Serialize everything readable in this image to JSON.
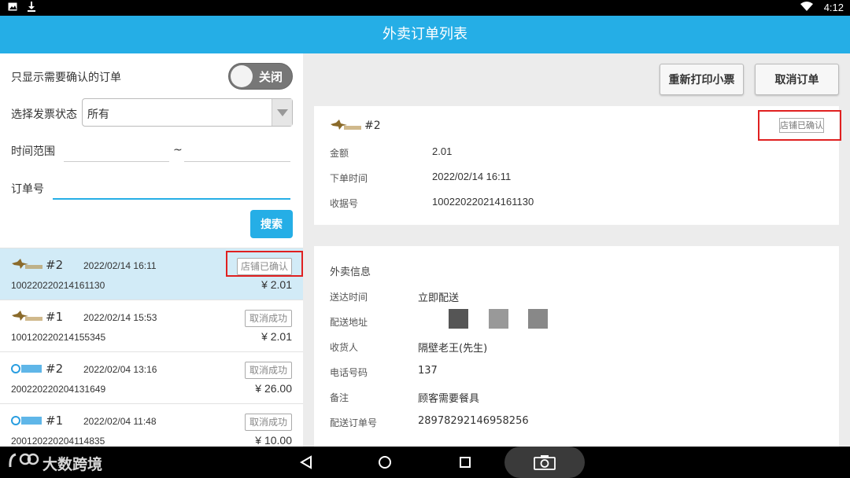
{
  "status_bar": {
    "time": "4:12"
  },
  "header": {
    "title": "外卖订单列表"
  },
  "filters": {
    "confirm_only_label": "只显示需要确认的订单",
    "toggle_label": "关闭",
    "invoice_label": "选择发票状态",
    "invoice_value": "所有",
    "time_range_label": "时间范围",
    "time_separator": "~",
    "order_no_label": "订单号",
    "search_label": "搜索"
  },
  "orders": [
    {
      "num": "#2",
      "date": "2022/02/14 16:11",
      "status": "店铺已确认",
      "id": "100220220214161130",
      "amount": "¥ 2.01",
      "platform": "meituan"
    },
    {
      "num": "#1",
      "date": "2022/02/14 15:53",
      "status": "取消成功",
      "id": "100120220214155345",
      "amount": "¥ 2.01",
      "platform": "meituan"
    },
    {
      "num": "#2",
      "date": "2022/02/04 13:16",
      "status": "取消成功",
      "id": "200220220204131649",
      "amount": "¥ 26.00",
      "platform": "eleme"
    },
    {
      "num": "#1",
      "date": "2022/02/04 11:48",
      "status": "取消成功",
      "id": "200120220204114835",
      "amount": "¥ 10.00",
      "platform": "eleme"
    }
  ],
  "actions": {
    "reprint_label": "重新打印小票",
    "cancel_label": "取消订单"
  },
  "detail": {
    "num": "#2",
    "status": "店铺已确认",
    "amount_label": "金额",
    "amount_value": "2.01",
    "order_time_label": "下单时间",
    "order_time_value": "2022/02/14 16:11",
    "receipt_label": "收据号",
    "receipt_value": "100220220214161130"
  },
  "delivery": {
    "section_title": "外卖信息",
    "time_label": "送达时间",
    "time_value": "立即配送",
    "address_label": "配送地址",
    "recipient_label": "收货人",
    "recipient_value": "隔壁老王(先生)",
    "phone_label": "电话号码",
    "phone_value": "137",
    "note_label": "备注",
    "note_value": "顾客需要餐具",
    "delivery_no_label": "配送订单号",
    "delivery_no_value": "28978292146958256"
  },
  "watermark": {
    "text": "大数跨境"
  },
  "colors": {
    "primary": "#25aee6",
    "highlight_box": "#e02020",
    "selected_row": "#d2ebf7"
  }
}
